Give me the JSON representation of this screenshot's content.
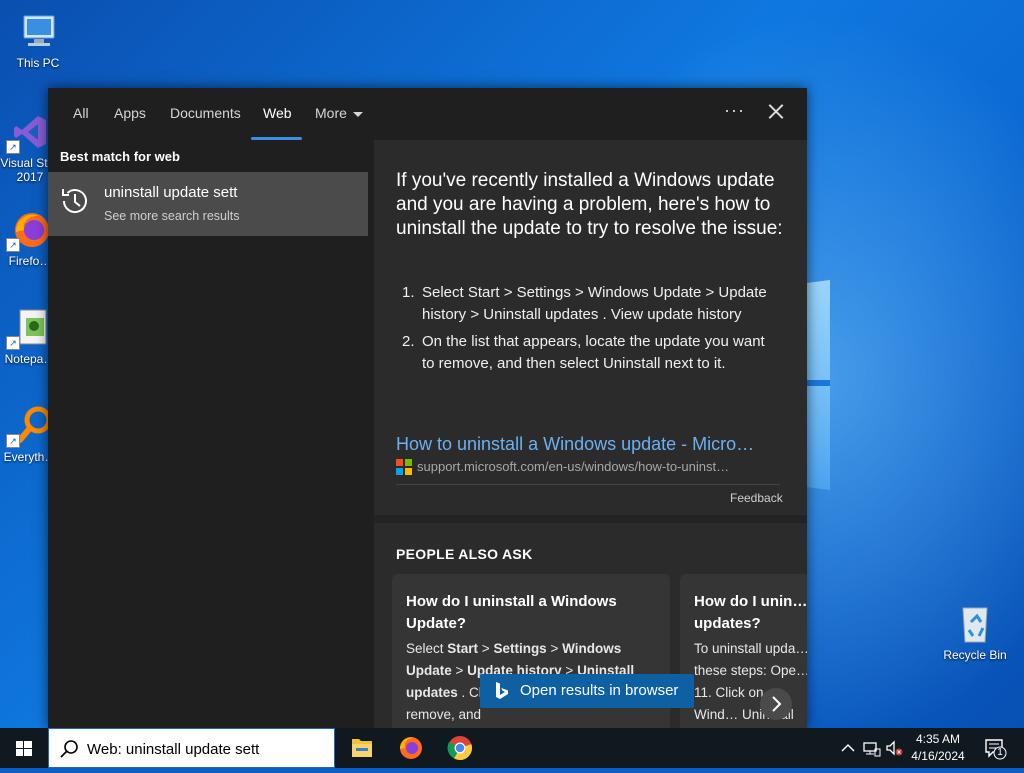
{
  "desktop": {
    "icons": [
      {
        "label": "This PC",
        "name": "desktop-icon-this-pc"
      },
      {
        "label": "Visual St… 2017",
        "name": "desktop-icon-visual-studio"
      },
      {
        "label": "Firefo…",
        "name": "desktop-icon-firefox"
      },
      {
        "label": "Notepa…",
        "name": "desktop-icon-notepad"
      },
      {
        "label": "Everyth…",
        "name": "desktop-icon-everything"
      },
      {
        "label": "Recycle Bin",
        "name": "desktop-icon-recycle-bin"
      }
    ]
  },
  "search_panel": {
    "tabs": [
      "All",
      "Apps",
      "Documents",
      "Web",
      "More"
    ],
    "active_tab": "Web",
    "options_label": "···",
    "best_match_label": "Best match for web",
    "best_match": {
      "title": "uninstall update sett",
      "subtitle": "See more search results"
    },
    "answer": {
      "heading": "If you've recently installed a Windows update and you are having a problem, here's how to uninstall the update to try to resolve the issue:",
      "steps": [
        {
          "num": "1.",
          "text": "Select Start > Settings > Windows Update > Update history > Uninstall updates . View update history"
        },
        {
          "num": "2.",
          "text": "On the list that appears, locate the update you want to remove, and then select Uninstall next to it."
        }
      ],
      "source_title": "How to uninstall a Windows update - Micro…",
      "source_url": "support.microsoft.com/en-us/windows/how-to-uninst…",
      "feedback": "Feedback"
    },
    "people_also_ask": {
      "title": "PEOPLE ALSO ASK",
      "cards": [
        {
          "question": "How do I uninstall a Windows Update?",
          "answer_parts": [
            "Select ",
            "Start",
            " > ",
            "Settings",
            " > ",
            "Windows Update",
            " > ",
            "Update history",
            " > ",
            "Uninstall updates",
            " . Choose the update you want to remove, and"
          ]
        },
        {
          "question": "How do I unin… updates?",
          "answer": "To uninstall upda… these steps: Ope… 11. Click on Wind… Uninstall update…"
        }
      ]
    },
    "open_in_browser": "Open results in browser"
  },
  "taskbar": {
    "search_value": "Web: uninstall update sett",
    "clock_time": "4:35 AM",
    "clock_date": "4/16/2024",
    "notification_count": "1"
  }
}
